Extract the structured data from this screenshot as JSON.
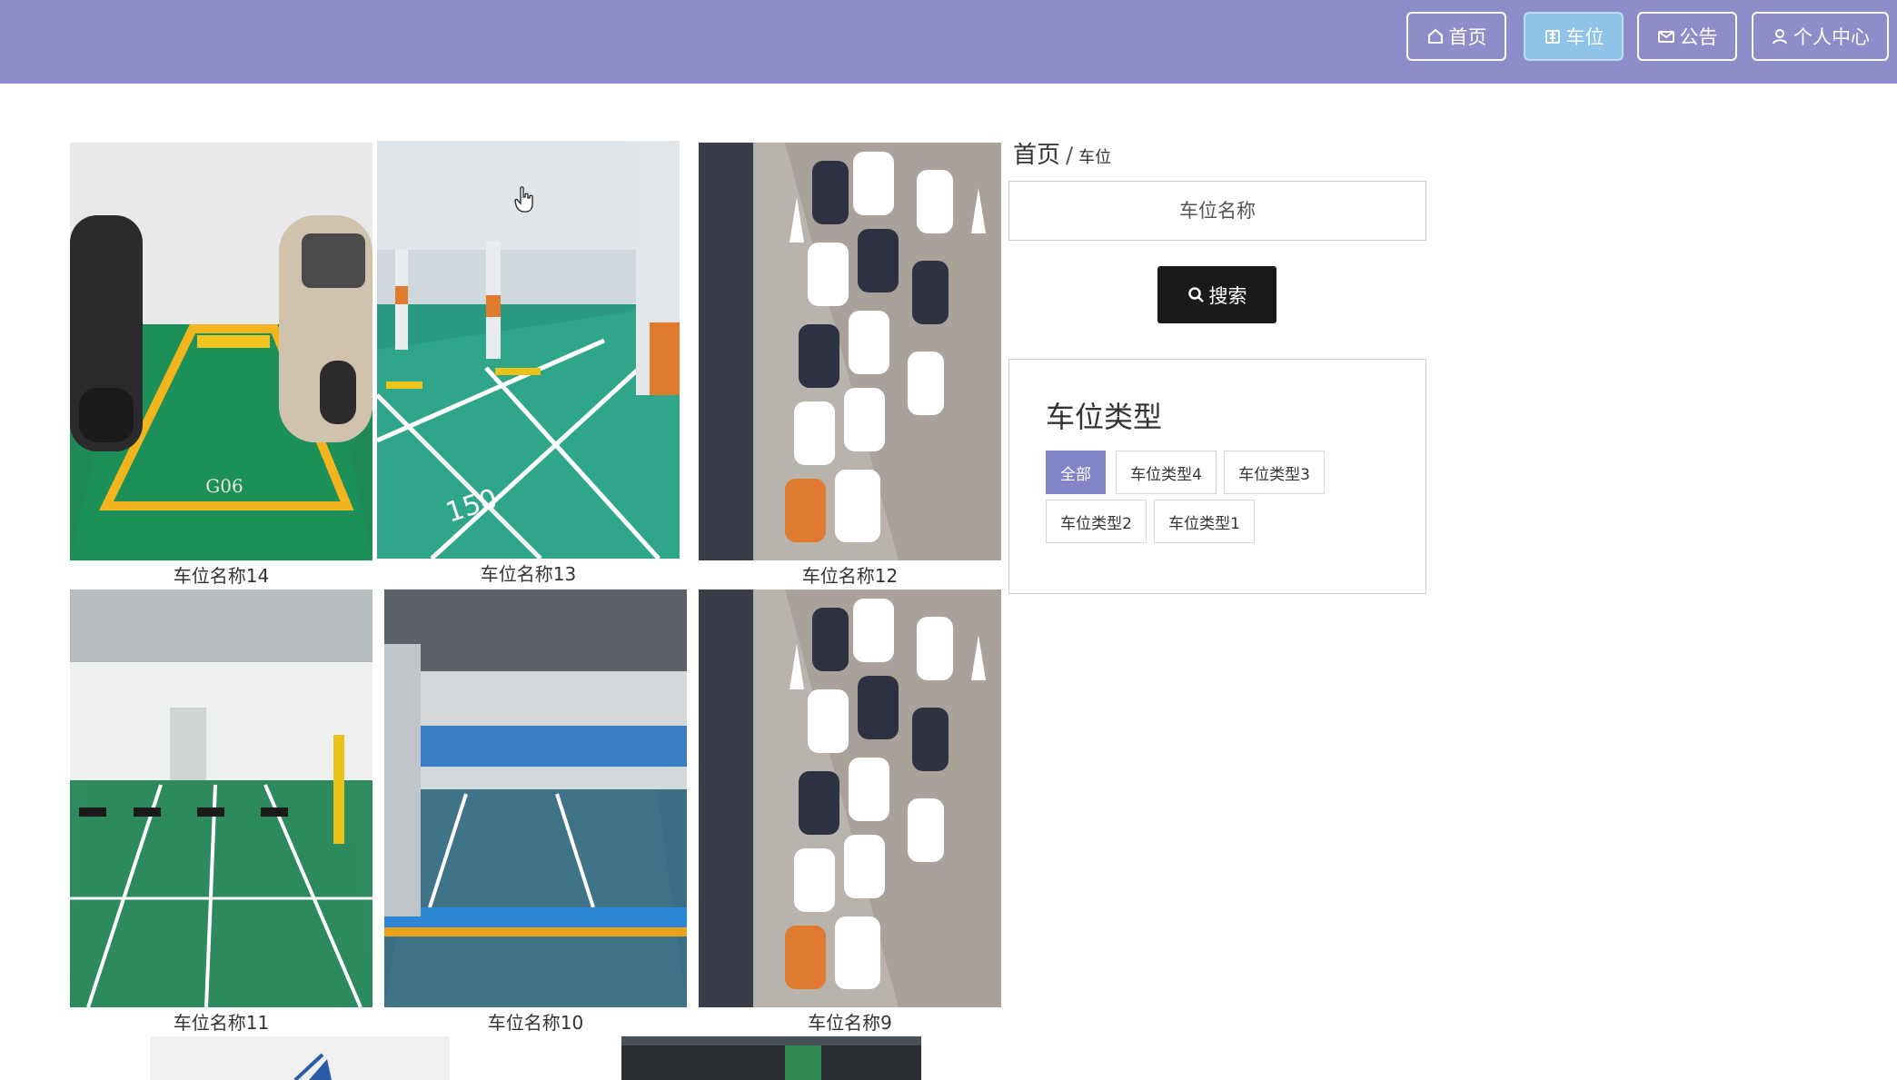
{
  "nav": {
    "home": "首页",
    "spaces": "车位",
    "notice": "公告",
    "user": "个人中心",
    "home_icon": "home-icon",
    "spaces_icon": "parking-icon",
    "notice_icon": "mail-icon",
    "user_icon": "user-icon"
  },
  "breadcrumb": {
    "root": "首页",
    "separator": "/",
    "current": "车位"
  },
  "search": {
    "placeholder": "车位名称",
    "button_label": "搜索",
    "button_icon": "search-icon"
  },
  "types": {
    "title": "车位类型",
    "items": [
      "全部",
      "车位类型4",
      "车位类型3",
      "车位类型2",
      "车位类型1"
    ],
    "selected": "全部"
  },
  "spaces": [
    {
      "name": "车位名称14"
    },
    {
      "name": "车位名称13"
    },
    {
      "name": "车位名称12"
    },
    {
      "name": "车位名称11"
    },
    {
      "name": "车位名称10"
    },
    {
      "name": "车位名称9"
    }
  ],
  "colors": {
    "nav_bg": "#8c8dc9",
    "nav_active": "#90c3ea",
    "tag_active": "#8485c6",
    "search_button": "#1a1a1a"
  }
}
